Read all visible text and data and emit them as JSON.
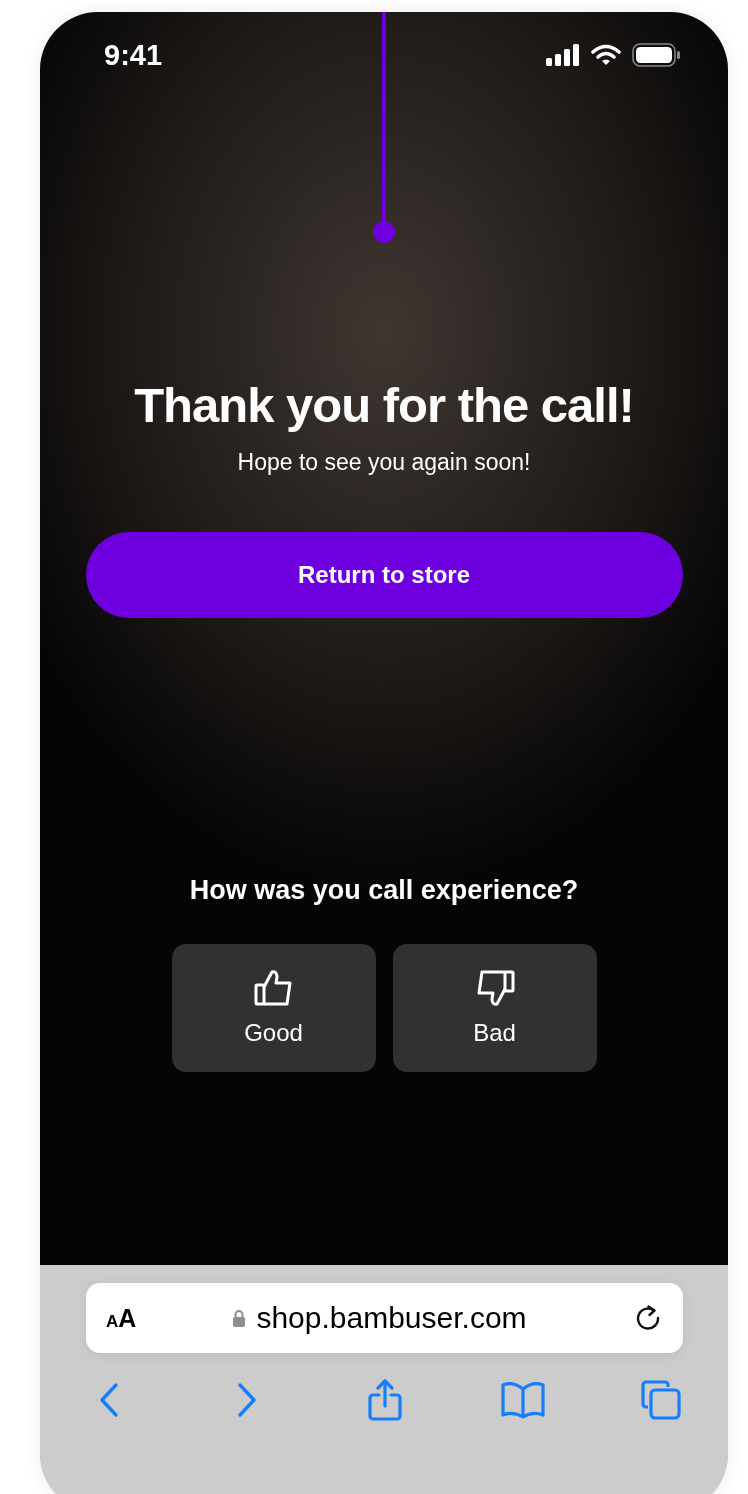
{
  "status_bar": {
    "time": "9:41"
  },
  "title": "Thank you for the call!",
  "subtitle": "Hope to see you again soon!",
  "primary_button": {
    "label": "Return to store"
  },
  "rating": {
    "question": "How was you call experience?",
    "options": [
      {
        "kind": "thumbs_up",
        "label": "Good"
      },
      {
        "kind": "thumbs_down",
        "label": "Bad"
      }
    ]
  },
  "browser": {
    "text_size_button": {
      "small": "A",
      "large": "A"
    },
    "url": "shop.bambuser.com"
  }
}
